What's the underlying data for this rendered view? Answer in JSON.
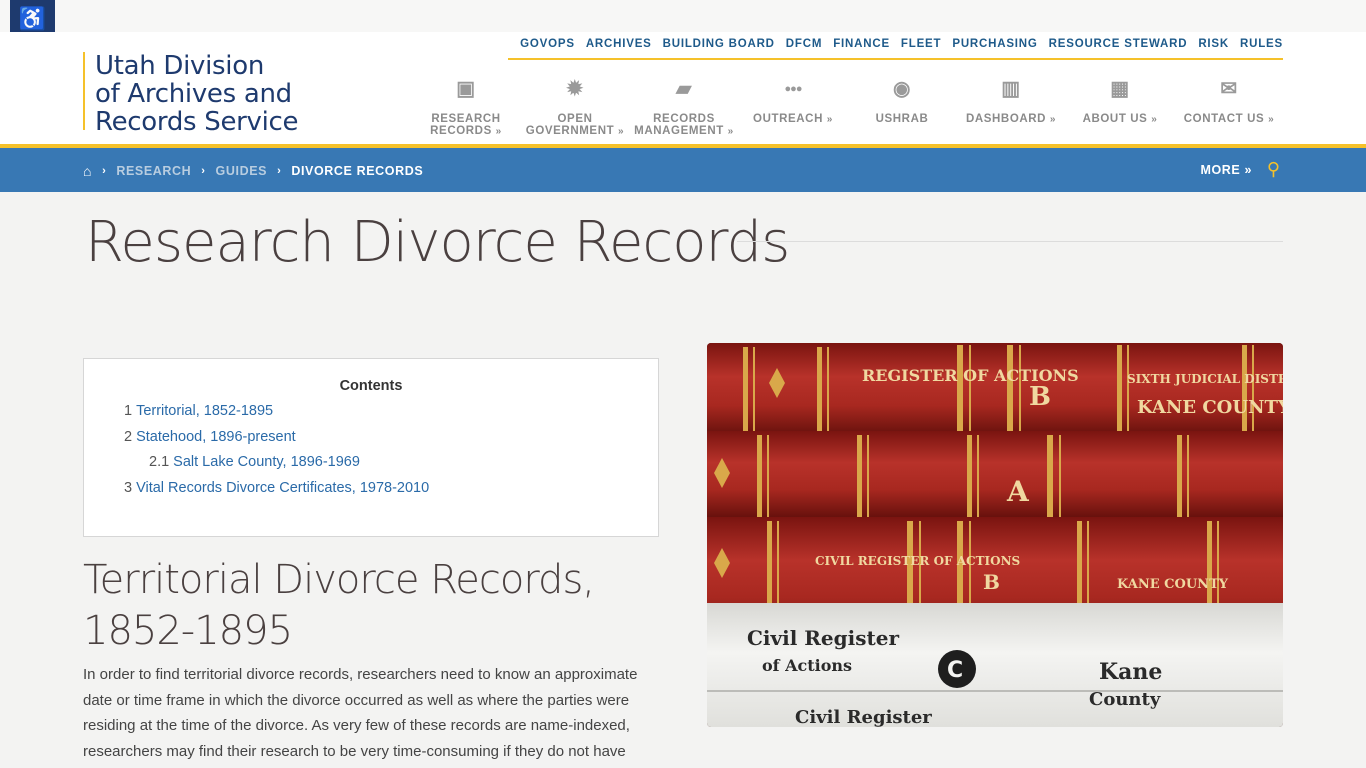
{
  "accessibility": {
    "icon": "wheelchair-icon",
    "glyph": "♿"
  },
  "logo": {
    "line1": "Utah Division",
    "line2": "of Archives and",
    "line3": "Records Service"
  },
  "util_nav": [
    "GOVOPS",
    "ARCHIVES",
    "BUILDING BOARD",
    "DFCM",
    "FINANCE",
    "FLEET",
    "PURCHASING",
    "RESOURCE STEWARD",
    "RISK",
    "RULES"
  ],
  "main_nav": [
    {
      "line1": "RESEARCH",
      "line2": "RECORDS",
      "icon": "archive-box-icon",
      "glyph": "▣",
      "chev": "»"
    },
    {
      "line1": "OPEN",
      "line2": "GOVERNMENT",
      "icon": "sun-icon",
      "glyph": "✹",
      "chev": "»"
    },
    {
      "line1": "RECORDS",
      "line2": "MANAGEMENT",
      "icon": "folder-open-icon",
      "glyph": "▰",
      "chev": "»"
    },
    {
      "line1": "OUTREACH",
      "line2": "",
      "icon": "users-icon",
      "glyph": "●●●",
      "chev": "»"
    },
    {
      "line1": "USHRAB",
      "line2": "",
      "icon": "user-circle-icon",
      "glyph": "◉",
      "chev": ""
    },
    {
      "line1": "DASHBOARD",
      "line2": "",
      "icon": "bar-chart-icon",
      "glyph": "▥",
      "chev": "»"
    },
    {
      "line1": "ABOUT US",
      "line2": "",
      "icon": "building-icon",
      "glyph": "▦",
      "chev": "»"
    },
    {
      "line1": "CONTACT US",
      "line2": "",
      "icon": "envelope-icon",
      "glyph": "✉",
      "chev": "»"
    }
  ],
  "breadcrumb": {
    "home_glyph": "⌂",
    "sep": "›",
    "items": [
      "RESEARCH",
      "GUIDES"
    ],
    "current": "DIVORCE RECORDS"
  },
  "more_label": "MORE »",
  "search_glyph": "⚲",
  "page_title": "Research Divorce Records",
  "toc": {
    "title": "Contents",
    "items": [
      {
        "num": "1",
        "label": "Territorial, 1852-1895"
      },
      {
        "num": "2",
        "label": "Statehood, 1896-present"
      },
      {
        "num": "2.1",
        "label": "Salt Lake County, 1896-1969"
      },
      {
        "num": "3",
        "label": "Vital Records Divorce Certificates, 1978-2010"
      }
    ]
  },
  "section_heading": "Territorial Divorce Records, 1852-1895",
  "section_text": "In order to find territorial divorce records, researchers need to know an approximate date or time frame in which the divorce occurred as well as where the parties were residing at the time of the divorce. As very few of these records are name-indexed, researchers may find their research to be very time-consuming if they do not have",
  "photo": {
    "book1_left": "REGISTER OF ACTIONS",
    "book1_letter": "B",
    "book1_right1": "SIXTH JUDICIAL DISTRICT COURT",
    "book1_right2": "KANE COUNTY",
    "book2_letter": "A",
    "book3_left": "CIVIL REGISTER OF ACTIONS",
    "book3_letter": "B",
    "book3_right": "KANE COUNTY",
    "book4_left1": "Civil Register",
    "book4_left2": "of Actions",
    "book4_letter": "C",
    "book4_right1": "Kane",
    "book4_right2": "County",
    "book5_left": "Civil Register"
  }
}
